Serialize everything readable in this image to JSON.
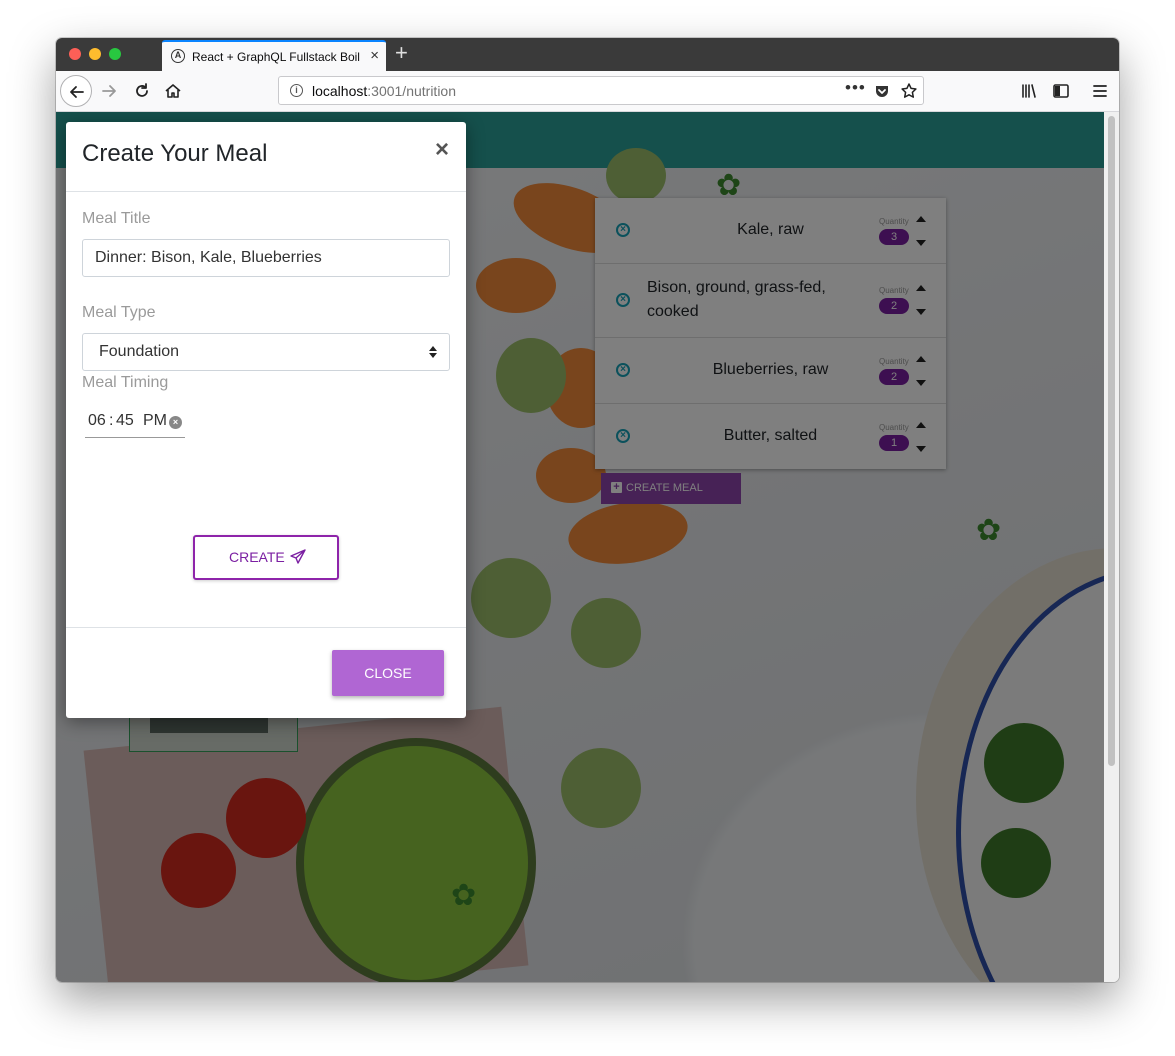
{
  "browser": {
    "tab_title": "React + GraphQL Fullstack Boile",
    "favicon_letter": "A",
    "url_host": "localhost",
    "url_path": ":3001/nutrition",
    "more_label": "•••"
  },
  "meal_list": {
    "quantity_label": "Quantity",
    "items": [
      {
        "name": "Kale, raw",
        "quantity": "3"
      },
      {
        "name": "Bison, ground, grass-fed, cooked",
        "quantity": "2"
      },
      {
        "name": "Blueberries, raw",
        "quantity": "2"
      },
      {
        "name": "Butter, salted",
        "quantity": "1"
      }
    ],
    "create_meal_label": "CREATE MEAL"
  },
  "modal": {
    "title": "Create Your Meal",
    "close_x": "×",
    "meal_title_label": "Meal Title",
    "meal_title_value": "Dinner: Bison, Kale, Blueberries",
    "meal_type_label": "Meal Type",
    "meal_type_value": "Foundation",
    "meal_timing_label": "Meal Timing",
    "time_hour": "06",
    "time_sep": ":",
    "time_minute": "45",
    "time_ampm": "PM",
    "create_label": "CREATE",
    "close_label": "CLOSE"
  },
  "colors": {
    "header_teal": "#2aa198",
    "purple_badge": "#7b1fa2",
    "close_button": "#b066d3",
    "remove_icon": "#17a2b8"
  }
}
